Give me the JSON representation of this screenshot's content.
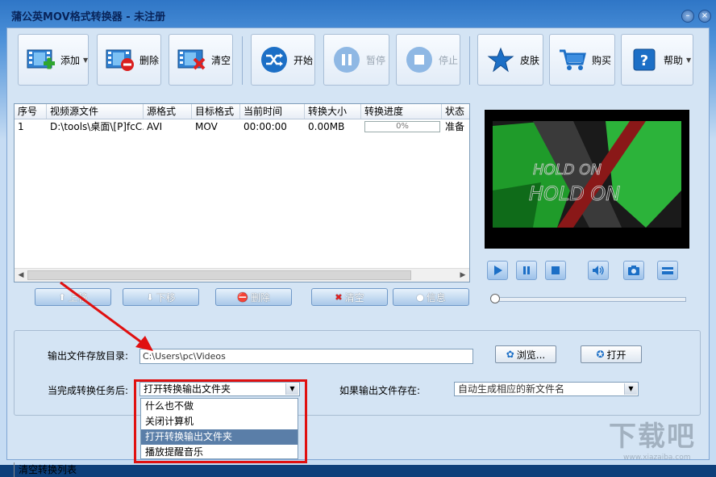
{
  "window": {
    "title": "蒲公英MOV格式转换器 - 未注册"
  },
  "toolbar": {
    "add": "添加",
    "delete": "删除",
    "clear": "清空",
    "start": "开始",
    "pause": "暂停",
    "stop": "停止",
    "skin": "皮肤",
    "buy": "购买",
    "help": "帮助"
  },
  "table": {
    "headers": [
      "序号",
      "视频源文件",
      "源格式",
      "目标格式",
      "当前时间",
      "转换大小",
      "转换进度",
      "状态"
    ],
    "rows": [
      {
        "index": "1",
        "file": "D:\\tools\\桌面\\[P]fcC...",
        "src": "AVI",
        "dst": "MOV",
        "time": "00:00:00",
        "size": "0.00MB",
        "progress": "0%",
        "status": "准备"
      }
    ]
  },
  "listButtons": {
    "up": "上移",
    "down": "下移",
    "delete": "删除",
    "clear": "清空",
    "info": "信息"
  },
  "preview": {
    "text1": "HOLD ON",
    "text2": "HOLD ON"
  },
  "settings": {
    "output_label": "输出文件存放目录:",
    "output_path": "C:\\Users\\pc\\Videos",
    "browse": "浏览...",
    "open": "打开",
    "after_label": "当完成转换任务后:",
    "after_value": "打开转换输出文件夹",
    "exists_label": "如果输出文件存在:",
    "exists_value": "自动生成相应的新文件名"
  },
  "dropdown": {
    "options": [
      "什么也不做",
      "关闭计算机",
      "打开转换输出文件夹",
      "播放提醒音乐"
    ],
    "selected_index": 2
  },
  "status": {
    "text": "清空转换列表"
  },
  "watermark": {
    "text": "下载吧",
    "url": "www.xiazaiba.com"
  },
  "colors": {
    "accent": "#e01010",
    "selection": "#5a7ea8"
  }
}
